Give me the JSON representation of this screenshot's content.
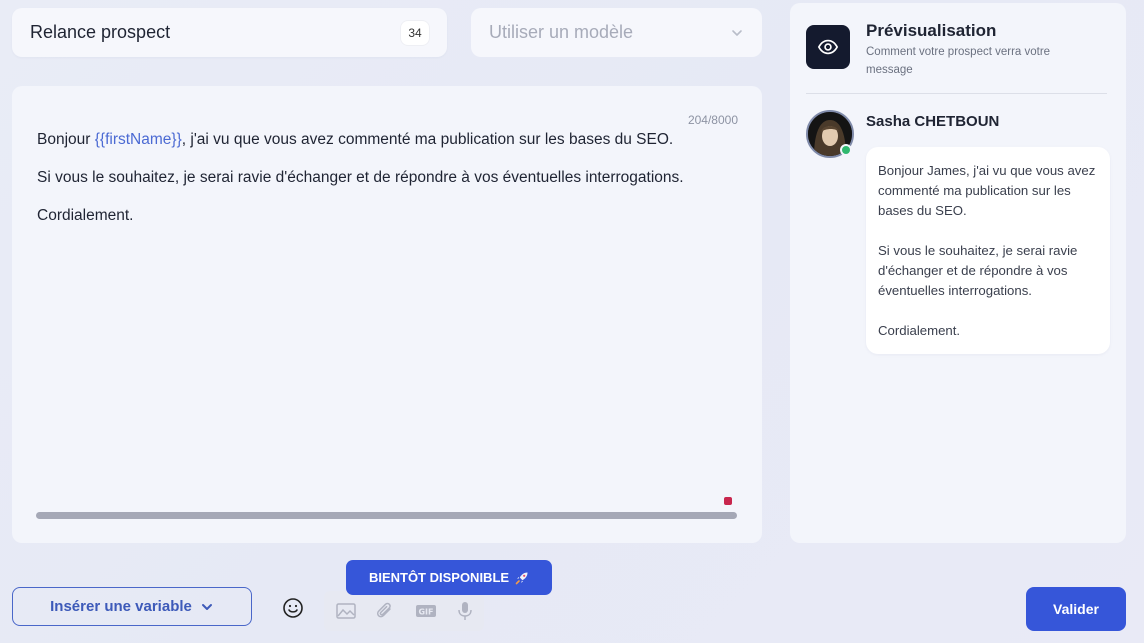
{
  "header": {
    "message_title": "Relance prospect",
    "title_count": "34",
    "template_placeholder": "Utiliser un modèle"
  },
  "editor": {
    "char_count": "204/8000",
    "line1_prefix": "Bonjour ",
    "line1_variable": "{{firstName}}",
    "line1_suffix": ", j'ai vu que vous avez commenté ma publication sur les bases du SEO.",
    "line2": "Si vous le souhaitez, je serai ravie d'échanger et de répondre à vos éventuelles interrogations.",
    "line3": "Cordialement."
  },
  "preview": {
    "title": "Prévisualisation",
    "subtitle": "Comment votre prospect verra votre message",
    "sender_name": "Sasha CHETBOUN",
    "message_p1": "Bonjour James, j'ai vu que vous avez commenté ma publication sur les bases du SEO.",
    "message_p2": "Si vous le souhaitez, je serai ravie d'échanger et de répondre à vos éventuelles interrogations.",
    "message_p3": "Cordialement.",
    "online_color": "#2fb86f"
  },
  "toolbar": {
    "insert_variable_label": "Insérer une variable",
    "coming_soon_label": "BIENTÔT DISPONIBLE",
    "validate_label": "Valider",
    "icons": [
      "emoji-icon",
      "image-icon",
      "attachment-icon",
      "gif-icon",
      "microphone-icon"
    ]
  },
  "colors": {
    "accent": "#3656d9",
    "variable": "#4b6ad3"
  }
}
